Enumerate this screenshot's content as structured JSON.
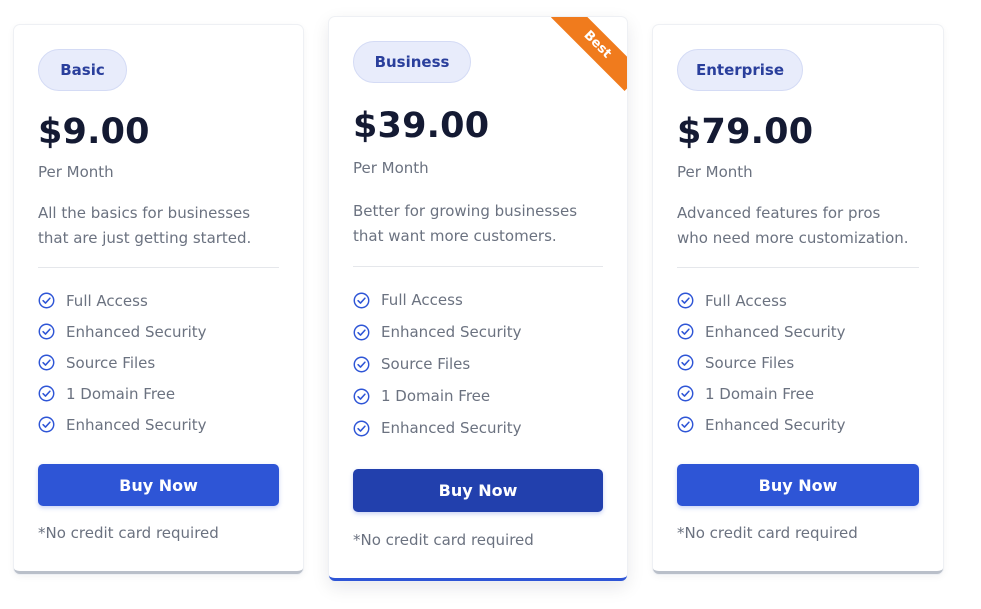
{
  "plans": [
    {
      "badge": "Basic",
      "price": "$9.00",
      "period": "Per Month",
      "description": "All the basics for businesses that are just getting started.",
      "features": [
        "Full Access",
        "Enhanced Security",
        "Source Files",
        "1 Domain Free",
        "Enhanced Security"
      ],
      "button_label": "Buy Now",
      "note": "*No credit card required"
    },
    {
      "badge": "Business",
      "ribbon": "Best",
      "price": "$39.00",
      "period": "Per Month",
      "description": "Better for growing businesses that want more customers.",
      "features": [
        "Full Access",
        "Enhanced Security",
        "Source Files",
        "1 Domain Free",
        "Enhanced Security"
      ],
      "button_label": "Buy Now",
      "note": "*No credit card required"
    },
    {
      "badge": "Enterprise",
      "price": "$79.00",
      "period": "Per Month",
      "description": "Advanced features for pros who need more customization.",
      "features": [
        "Full Access",
        "Enhanced Security",
        "Source Files",
        "1 Domain Free",
        "Enhanced Security"
      ],
      "button_label": "Buy Now",
      "note": "*No credit card required"
    }
  ],
  "icons": {
    "feature": "check-circle-icon"
  },
  "colors": {
    "accent": "#2e55d6",
    "accent_dark": "#2240ad",
    "ribbon": "#f07b1d",
    "badge_bg": "#e8ecfb",
    "price": "#141a33"
  }
}
